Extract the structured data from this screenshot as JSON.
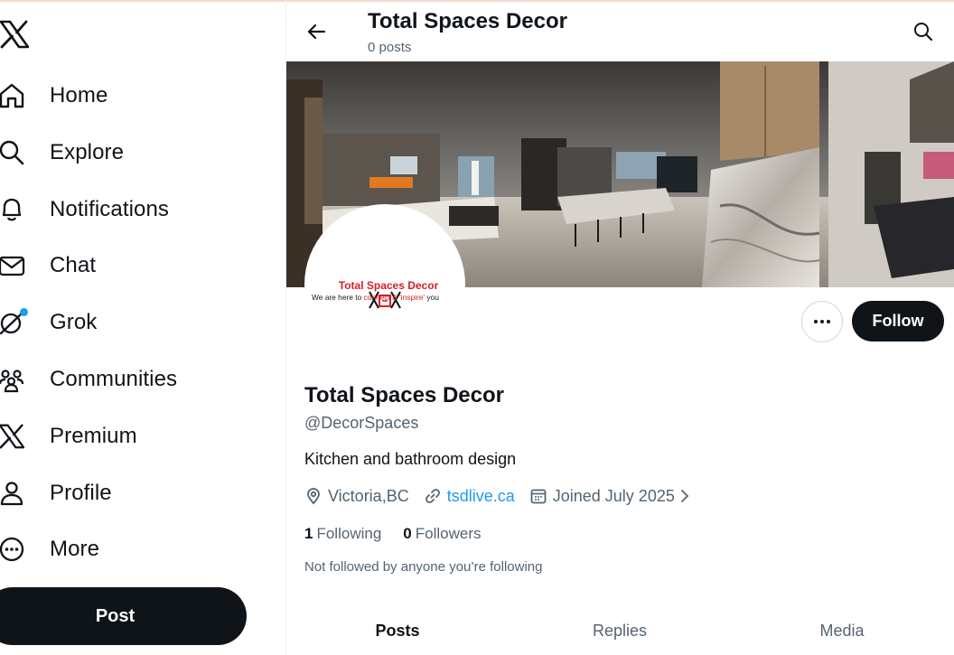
{
  "sidebar": {
    "logo_icon": "x-logo-icon",
    "items": [
      {
        "label": "Home",
        "icon": "home-icon"
      },
      {
        "label": "Explore",
        "icon": "search-icon"
      },
      {
        "label": "Notifications",
        "icon": "bell-icon"
      },
      {
        "label": "Chat",
        "icon": "mail-icon"
      },
      {
        "label": "Grok",
        "icon": "grok-icon"
      },
      {
        "label": "Communities",
        "icon": "communities-icon"
      },
      {
        "label": "Premium",
        "icon": "x-logo-icon"
      },
      {
        "label": "Profile",
        "icon": "person-icon"
      },
      {
        "label": "More",
        "icon": "more-circle-icon"
      }
    ],
    "post_label": "Post"
  },
  "header": {
    "title": "Total Spaces Decor",
    "post_count": "0 posts"
  },
  "profile": {
    "avatar": {
      "brand": "Total Spaces Decor",
      "tagline_start": "We are here to ",
      "tagline_red": "connect & 'inspire'",
      "tagline_end": " you"
    },
    "name": "Total Spaces Decor",
    "handle": "@DecorSpaces",
    "bio": "Kitchen and bathroom design",
    "location": "Victoria,BC",
    "website": "tsdlive.ca",
    "joined": "Joined July 2025",
    "following_count": "1",
    "following_label": "Following",
    "followers_count": "0",
    "followers_label": "Followers",
    "not_followed": "Not followed by anyone you’re following",
    "follow_label": "Follow"
  },
  "tabs": [
    {
      "label": "Posts",
      "active": true
    },
    {
      "label": "Replies",
      "active": false
    },
    {
      "label": "Media",
      "active": false
    }
  ],
  "colors": {
    "accent": "#1d9bf0",
    "text": "#0f1419",
    "secondary": "#536471",
    "button_dark": "#0f1419",
    "brand_red": "#d61f26"
  }
}
